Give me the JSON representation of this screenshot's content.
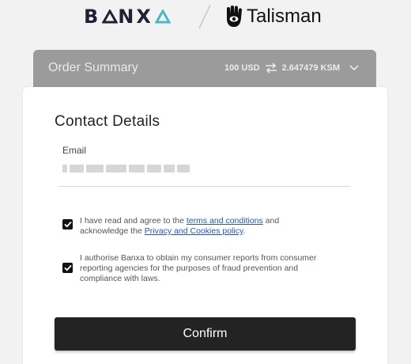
{
  "brand": {
    "banxa_text": "BANXA",
    "partner_name": "Talisman"
  },
  "order_summary": {
    "title": "Order Summary",
    "from_amount": "100 USD",
    "to_amount": "2.647479 KSM"
  },
  "form": {
    "title": "Contact Details",
    "email_label": "Email",
    "email_value_redacted": true,
    "terms": {
      "prefix": "I have read and agree to the ",
      "link1": "terms and conditions",
      "middle": " and acknowledge the ",
      "link2": "Privacy and Cookies policy",
      "suffix": ".",
      "checked": true
    },
    "consent": {
      "text": "I authorise Banxa to obtain my consumer reports from consumer reporting agencies for the purposes of fraud prevention and compliance with laws.",
      "checked": true
    },
    "confirm_label": "Confirm"
  },
  "colors": {
    "banxa_navy": "#1f2235",
    "banxa_teal": "#4fb7c4",
    "summary_bg": "#9b9b9b",
    "button_bg": "#232323",
    "link": "#2255cc"
  },
  "icons": [
    "banxa-triangle-icon",
    "talisman-hand-icon",
    "swap-arrows-icon",
    "chevron-down-icon",
    "checkmark-icon"
  ]
}
